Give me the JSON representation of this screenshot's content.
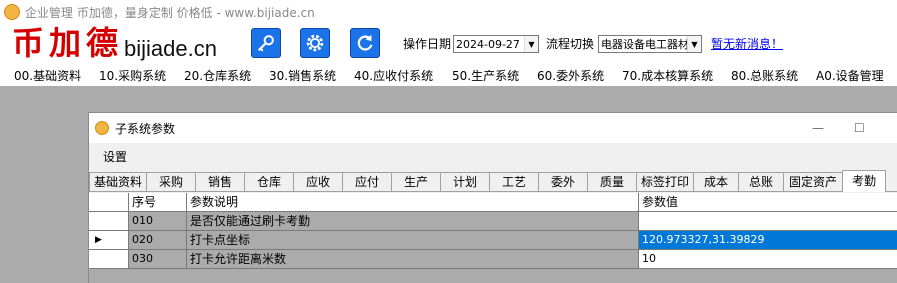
{
  "app": {
    "title_bar": "企业管理 币加德，量身定制 价格低 - www.bijiade.cn",
    "icon_text": "币加德"
  },
  "logo": {
    "chars": "币加德",
    "domain": "bijiade.cn",
    "color": "#d40000"
  },
  "toolbar": {
    "buttons": [
      {
        "icon": "key-icon"
      },
      {
        "icon": "gear-icon"
      },
      {
        "icon": "refresh-icon"
      }
    ],
    "accent": "#1a73e8",
    "date_label": "操作日期",
    "date_value": "2024-09-27",
    "flow_label": "流程切换",
    "flow_value": "电器设备电工器材",
    "message_link": "暂无新消息！"
  },
  "menu": {
    "items": [
      "00.基础资料",
      "10.采购系统",
      "20.仓库系统",
      "30.销售系统",
      "40.应收付系统",
      "50.生产系统",
      "60.委外系统",
      "70.成本核算系统",
      "80.总账系统",
      "A0.设备管理"
    ]
  },
  "subwindow": {
    "title": "子系统参数",
    "minimize": "—",
    "maximize": "☐",
    "settings_menu": "设置",
    "tabs": [
      "基础资料",
      "采购",
      "销售",
      "仓库",
      "应收",
      "应付",
      "生产",
      "计划",
      "工艺",
      "委外",
      "质量",
      "标签打印",
      "成本",
      "总账",
      "固定资产",
      "考勤"
    ],
    "active_tab": "考勤",
    "grid": {
      "headers": [
        "序号",
        "参数说明",
        "参数值"
      ],
      "rows": [
        {
          "no": "010",
          "desc": "是否仅能通过刷卡考勤",
          "value": "",
          "current": false
        },
        {
          "no": "020",
          "desc": "打卡点坐标",
          "value": "120.973327,31.39829",
          "current": true
        },
        {
          "no": "030",
          "desc": "打卡允许距离米数",
          "value": "10",
          "current": false
        }
      ],
      "selection_color": "#0078d7"
    }
  }
}
